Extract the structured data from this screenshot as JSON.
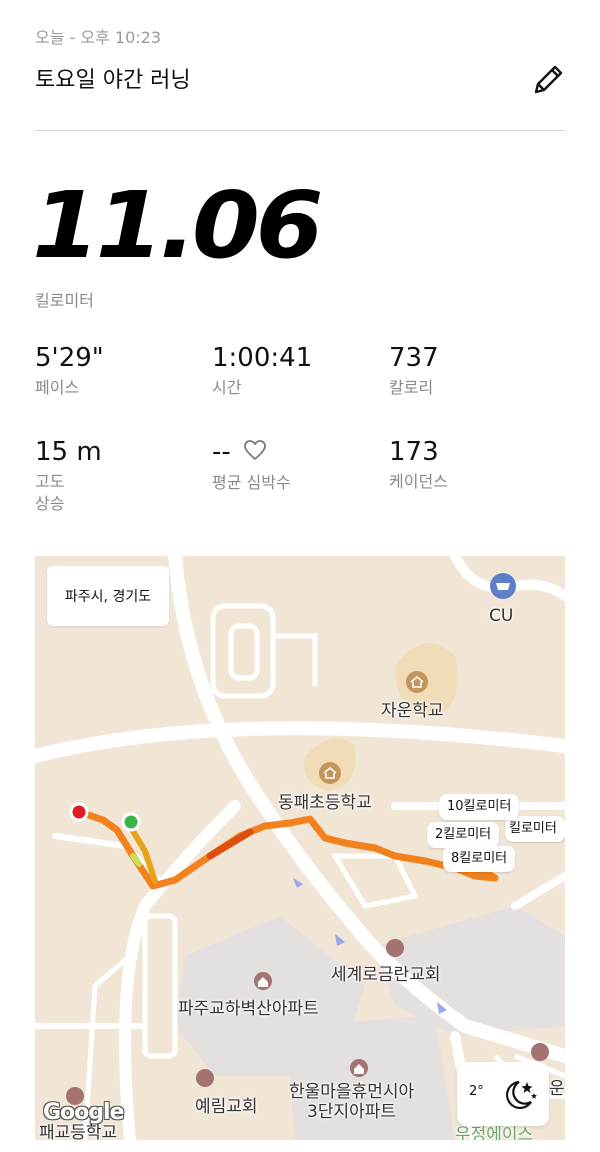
{
  "header": {
    "date": "오늘 - 오후 10:23",
    "title": "토요일 야간 러닝",
    "edit_icon": "pencil-icon"
  },
  "summary": {
    "distance": "11.06",
    "distance_unit": "킬로미터"
  },
  "stats": [
    {
      "value": "5'29\"",
      "label": "페이스"
    },
    {
      "value": "1:00:41",
      "label": "시간"
    },
    {
      "value": "737",
      "label": "칼로리"
    },
    {
      "value": "15 m",
      "label": "고도\n상승"
    },
    {
      "value": "--",
      "label": "평균 심박수",
      "icon": "heart-icon"
    },
    {
      "value": "173",
      "label": "케이던스"
    }
  ],
  "map": {
    "region": "파주시, 경기도",
    "km_markers": [
      "10킬로미터",
      "2킬로미터",
      "8킬로미터"
    ],
    "km_marker_peek": "킬로미터",
    "pois": {
      "cu": "CU",
      "school1": "자운학교",
      "school2": "동패초등학교",
      "church1": "세계로금란교회",
      "apt1": "파주교하벽산아파트",
      "church2": "예림교회",
      "apt2": "한울마을휴먼시아\n3단지아파트",
      "school3": "패교등학교",
      "edge1": "운",
      "edge2": "우정에이스"
    },
    "weather": {
      "temp": "2°",
      "icon": "moon-stars-icon"
    },
    "attribution": "Google",
    "colors": {
      "route": "#f07b12",
      "start": "#39b54a",
      "end": "#e01b24",
      "land": "#f1e5d6",
      "road": "#ffffff",
      "block": "#e2dedc"
    }
  }
}
